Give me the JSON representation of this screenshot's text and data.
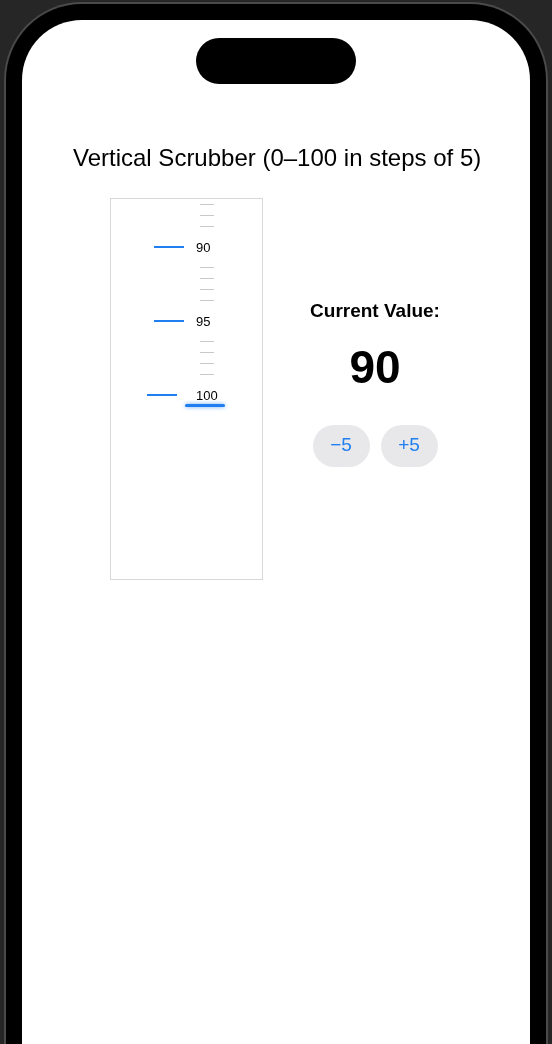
{
  "title": "Vertical Scrubber (0–100 in steps of 5)",
  "scrubber": {
    "marks": [
      {
        "kind": "minor"
      },
      {
        "kind": "minor"
      },
      {
        "kind": "minor"
      },
      {
        "kind": "major",
        "label": "90",
        "selected": false
      },
      {
        "kind": "minor"
      },
      {
        "kind": "minor"
      },
      {
        "kind": "minor"
      },
      {
        "kind": "minor"
      },
      {
        "kind": "major",
        "label": "95",
        "selected": false
      },
      {
        "kind": "minor"
      },
      {
        "kind": "minor"
      },
      {
        "kind": "minor"
      },
      {
        "kind": "minor"
      },
      {
        "kind": "major",
        "label": "100",
        "selected": true
      }
    ]
  },
  "current_label": "Current Value:",
  "current_value": "90",
  "buttons": [
    "−5",
    "+5"
  ]
}
